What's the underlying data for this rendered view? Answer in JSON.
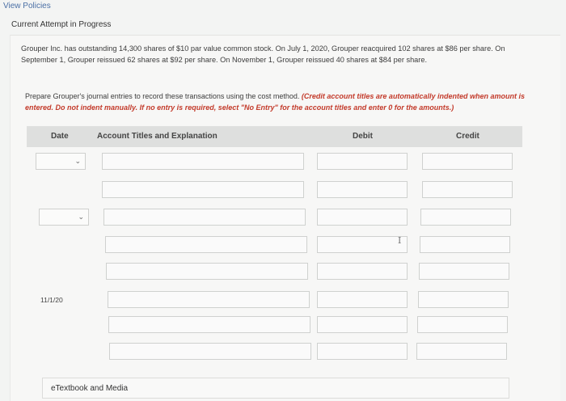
{
  "nav": {
    "view_policies": "View Policies"
  },
  "status": {
    "attempt": "Current Attempt in Progress"
  },
  "problem": {
    "text": "Grouper Inc. has outstanding 14,300 shares of $10 par value common stock. On July 1, 2020, Grouper reacquired 102 shares at $86 per share. On September 1, Grouper reissued 62 shares at $92 per share. On November 1, Grouper reissued 40 shares at $84 per share.",
    "instruction_plain": "Prepare Grouper's journal entries to record these transactions using the cost method. ",
    "instruction_red": "(Credit account titles are automatically indented when amount is entered. Do not indent manually. If no entry is required, select \"No Entry\" for the account titles and enter 0 for the amounts.)"
  },
  "table": {
    "headers": {
      "date": "Date",
      "account": "Account Titles and Explanation",
      "debit": "Debit",
      "credit": "Credit"
    },
    "date_label_row7": "11/1/20"
  },
  "footer": {
    "etextbook": "eTextbook and Media"
  }
}
